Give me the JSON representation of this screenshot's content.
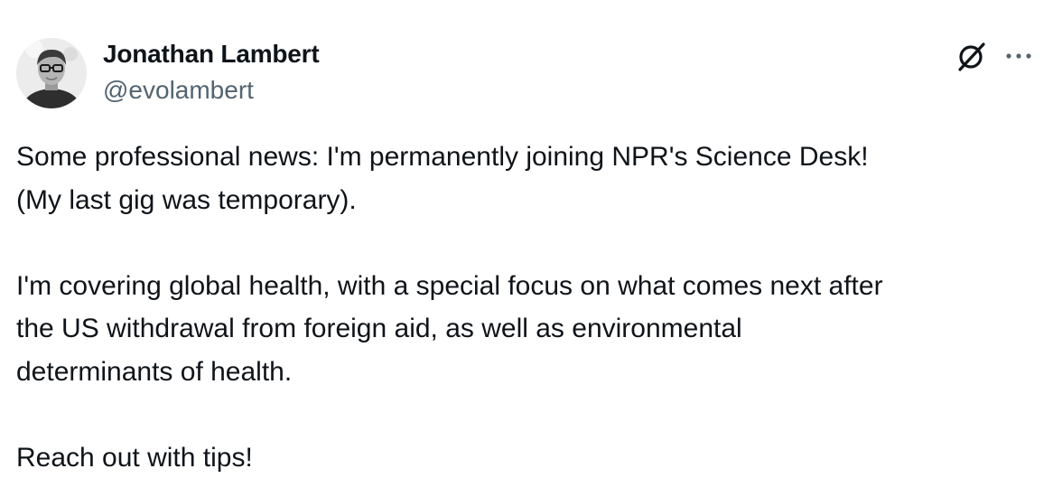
{
  "author": {
    "display_name": "Jonathan Lambert",
    "handle": "@evolambert"
  },
  "icons": {
    "grok": "grok-icon",
    "more": "more-options-icon"
  },
  "post": {
    "lines": [
      "Some professional news: I'm permanently joining NPR's Science Desk!",
      "(My last gig was temporary).",
      "",
      "I'm covering global health, with a special focus on what comes next after",
      "the US withdrawal from foreign aid, as well as environmental",
      "determinants of health.",
      "",
      "Reach out with tips!"
    ]
  },
  "colors": {
    "text_primary": "#0f1419",
    "text_secondary": "#536471"
  }
}
